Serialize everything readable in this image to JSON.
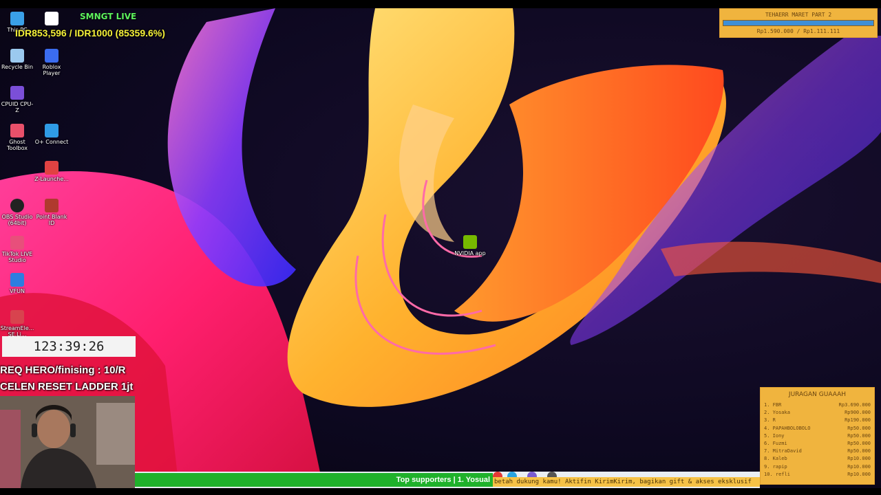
{
  "desktop_icons": [
    {
      "label": "This PC",
      "color": "#3aa0e8"
    },
    {
      "label": "",
      "color": "#ffffff"
    },
    {
      "label": "Recycle Bin",
      "color": "#9bc9ef"
    },
    {
      "label": "Roblox Player",
      "color": "#3b6cf0"
    },
    {
      "label": "CPUID CPU-Z",
      "color": "#7b4fd8"
    },
    {
      "label": "Ghost Toolbox",
      "color": "#e8506a"
    },
    {
      "label": "O+ Connect",
      "color": "#2f9be6"
    },
    {
      "label": "Z-Launche...",
      "color": "#e04242"
    },
    {
      "label": "OBS Studio (64bit)",
      "color": "#222222"
    },
    {
      "label": "Point Blank ID",
      "color": "#b03a2e"
    },
    {
      "label": "TikTok LIVE Studio",
      "color": "#e84f7b"
    },
    {
      "label": "VFUN",
      "color": "#2e7de0"
    },
    {
      "label": "StreamEle... SE.Li...",
      "color": "#d8434e"
    },
    {
      "label": "NVIDIA app",
      "color": "#76b900"
    }
  ],
  "overlay": {
    "stream_label": "SMNGT LIVE",
    "goal_text": "IDR853,596 / IDR1000 (85359.6%)",
    "timer": "123:39:26",
    "req_line_1": "REQ HERO/finising : 10/R",
    "req_line_2": "CELEN RESET LADDER 1jt"
  },
  "goal_box": {
    "title": "TEHAERR MARET PART 2",
    "amounts": "Rp1.590.000 / Rp1.111.111",
    "progress_pct": 100
  },
  "leaderboard": {
    "title": "JURAGAN GUAAAH",
    "rows": [
      {
        "name": "1. FBR",
        "amount": "Rp3.690.000"
      },
      {
        "name": "2. Yosaka",
        "amount": "Rp900.000"
      },
      {
        "name": "3. R",
        "amount": "Rp190.000"
      },
      {
        "name": "4. PAPAHBOLOBOLO",
        "amount": "Rp50.000"
      },
      {
        "name": "5. Iony",
        "amount": "Rp50.000"
      },
      {
        "name": "6. Fuzmi",
        "amount": "Rp50.000"
      },
      {
        "name": "7. MitraDavid",
        "amount": "Rp50.000"
      },
      {
        "name": "8. Kaleb",
        "amount": "Rp10.000"
      },
      {
        "name": "9. rapip",
        "amount": "Rp10.000"
      },
      {
        "name": "10. refli",
        "amount": "Rp10.000"
      }
    ]
  },
  "ticker": {
    "green_text": "Top supporters | 1. Yosual",
    "yellow_text": "betah dukung kamu!  Aktifin KirimKirim, bagikan gift & akses eksklusif"
  },
  "colors": {
    "overlay_yellow": "#f0b43e",
    "ticker_green": "#1fb12b",
    "goal_text": "#f4f03a",
    "stream_label": "#5df25d"
  }
}
